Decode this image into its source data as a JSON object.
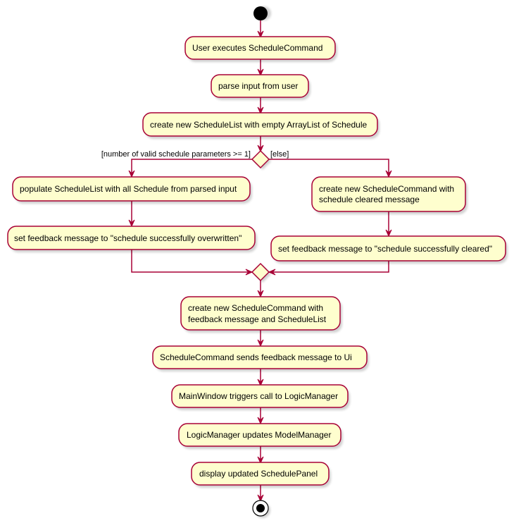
{
  "diagram": {
    "type": "activity",
    "colors": {
      "node_fill": "#FEFECE",
      "border": "#A80036",
      "start": "#000000"
    },
    "nodes": {
      "a1": "User executes ScheduleCommand",
      "a2": "parse input from user",
      "a3": "create new ScheduleList with empty ArrayList of Schedule",
      "l1": "populate ScheduleList with all Schedule from parsed input",
      "l2": "set feedback message to \"schedule successfully overwritten\"",
      "r1_line1": "create new ScheduleCommand with",
      "r1_line2": "schedule cleared message",
      "r2": "set feedback message to \"schedule successfully cleared\"",
      "m1_line1": "create new ScheduleCommand with",
      "m1_line2": "feedback message and ScheduleList",
      "m2": "ScheduleCommand sends feedback message to Ui",
      "m3": "MainWindow triggers call to LogicManager",
      "m4": "LogicManager updates ModelManager",
      "m5": "display updated SchedulePanel"
    },
    "guards": {
      "if_true": "[number of valid schedule parameters >= 1]",
      "else": "[else]"
    }
  }
}
